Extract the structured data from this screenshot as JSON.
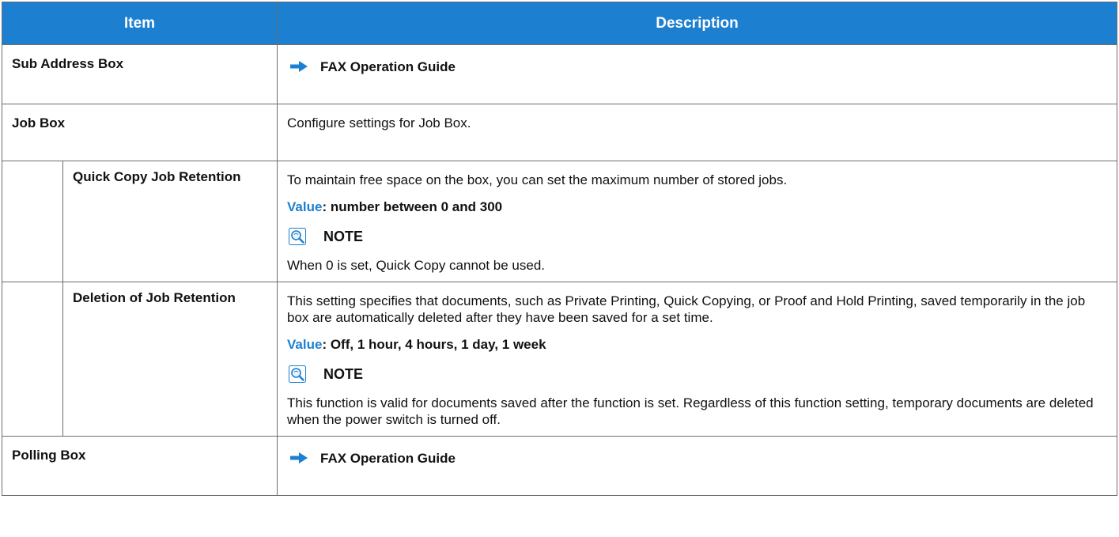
{
  "table": {
    "headers": {
      "item": "Item",
      "description": "Description"
    },
    "rows": {
      "sub_address_box": {
        "item": "Sub Address Box",
        "ref": "FAX Operation Guide"
      },
      "job_box": {
        "item": "Job Box",
        "description": "Configure settings for Job Box."
      },
      "quick_copy": {
        "item": "Quick Copy Job Retention",
        "description": "To maintain free space on the box, you can set the maximum number of stored jobs.",
        "value_label": "Value",
        "value_text": ": number between 0 and 300",
        "note_title": "NOTE",
        "note_text": "When 0 is set, Quick Copy cannot be used."
      },
      "deletion": {
        "item": "Deletion of Job Retention",
        "description": "This setting specifies that documents, such as Private Printing, Quick Copying, or Proof and Hold Printing, saved temporarily in the job box are automatically deleted after they have been saved for a set time.",
        "value_label": "Value",
        "value_text": ": Off, 1 hour, 4 hours, 1 day, 1 week",
        "note_title": "NOTE",
        "note_text": "This function is valid for documents saved after the function is set. Regardless of this function setting, temporary documents are deleted when the power switch is turned off."
      },
      "polling_box": {
        "item": "Polling Box",
        "ref": "FAX Operation Guide"
      }
    }
  },
  "colors": {
    "header_bg": "#1c7fd0",
    "accent": "#1c7fd0",
    "border": "#6d6d6d"
  },
  "icons": {
    "reference": "arrow-right-icon",
    "note": "note-magnifier-icon"
  }
}
